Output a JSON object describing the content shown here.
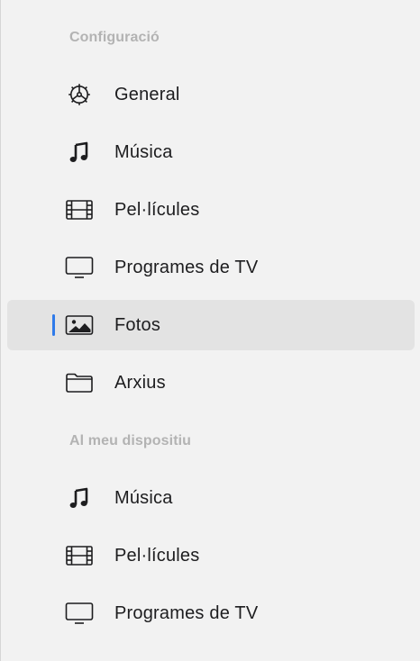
{
  "sidebar": {
    "sections": [
      {
        "header": "Configuració",
        "items": [
          {
            "label": "General",
            "icon": "gear-icon",
            "selected": false
          },
          {
            "label": "Música",
            "icon": "music-note-icon",
            "selected": false
          },
          {
            "label": "Pel·lícules",
            "icon": "film-icon",
            "selected": false
          },
          {
            "label": "Programes de TV",
            "icon": "tv-icon",
            "selected": false
          },
          {
            "label": "Fotos",
            "icon": "photo-icon",
            "selected": true
          },
          {
            "label": "Arxius",
            "icon": "folder-icon",
            "selected": false
          }
        ]
      },
      {
        "header": "Al meu dispositiu",
        "items": [
          {
            "label": "Música",
            "icon": "music-note-icon",
            "selected": false
          },
          {
            "label": "Pel·lícules",
            "icon": "film-icon",
            "selected": false
          },
          {
            "label": "Programes de TV",
            "icon": "tv-icon",
            "selected": false
          }
        ]
      }
    ]
  },
  "colors": {
    "background": "#f2f2f2",
    "selected_background": "#e3e3e3",
    "selection_indicator": "#2f7bea",
    "header_text": "#b3b3b3",
    "item_text": "#1d1d1f"
  }
}
